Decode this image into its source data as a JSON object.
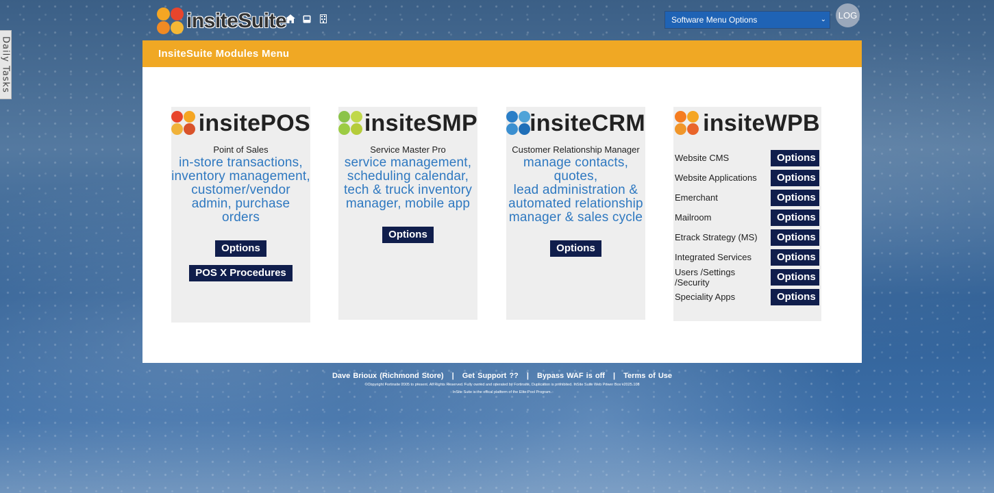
{
  "side_tab": {
    "label": "Daily Tasks"
  },
  "header": {
    "logo_text": "insiteSuite",
    "icons": [
      "home-icon",
      "inbox-icon",
      "building-icon"
    ],
    "menu_select": {
      "value": "Software Menu Options"
    },
    "log_button": "LOG"
  },
  "panel": {
    "title": "InsiteSuite Modules Menu",
    "modules": [
      {
        "name": "insitePOS",
        "subtitle": "Point of Sales",
        "desc_lines": [
          "in-store transactions,",
          "inventory management,",
          "customer/vendor",
          "admin, purchase orders"
        ],
        "buttons": [
          "Options",
          "POS X Procedures"
        ],
        "ball_colors": [
          "#e8452c",
          "#f5a623",
          "#f0b23a",
          "#d9532b"
        ]
      },
      {
        "name": "insiteSMP",
        "subtitle": "Service Master Pro",
        "desc_lines": [
          "service management,",
          "scheduling calendar,",
          "tech & truck inventory",
          "manager, mobile app"
        ],
        "buttons": [
          "Options"
        ],
        "ball_colors": [
          "#8bc34a",
          "#c0d84a",
          "#9ccc44",
          "#b5cc3a"
        ]
      },
      {
        "name": "insiteCRM",
        "subtitle": "Customer Relationship Manager",
        "desc_lines": [
          "manage contacts, quotes,",
          "lead administration &",
          "automated relationship",
          "manager & sales cycle"
        ],
        "buttons": [
          "Options"
        ],
        "ball_colors": [
          "#2a7ec7",
          "#4fa3d8",
          "#3b8fd0",
          "#1f6fb8"
        ]
      },
      {
        "name": "insiteWPB",
        "ball_colors": [
          "#f57c20",
          "#f5a623",
          "#f0962a",
          "#e9652a"
        ],
        "rows": [
          {
            "label": "Website CMS",
            "button": "Options"
          },
          {
            "label": "Website Applications",
            "button": "Options"
          },
          {
            "label": "Emerchant",
            "button": "Options"
          },
          {
            "label": "Mailroom",
            "button": "Options"
          },
          {
            "label": "Etrack Strategy (MS)",
            "button": "Options"
          },
          {
            "label": "Integrated Services",
            "button": "Options"
          },
          {
            "label": "Users /Settings /Security",
            "button": "Options"
          },
          {
            "label": "Speciality Apps",
            "button": "Options"
          }
        ]
      }
    ]
  },
  "footer": {
    "links": [
      "Dave Brioux (Richmond Store)",
      "Get Support ??",
      "Bypass WAF is off",
      "Terms of Use"
    ],
    "separator": "|",
    "copyright_line1": "©Copyright Fortinsite 2005 to present. All Rights Reserved. Fully owned and operated by Fortinsite, Duplication is prohibited. InSite Suite Web Power Box v2025.108",
    "copyright_line2": "InSite Suite is the offical platform of the Elite Pool Program."
  },
  "colors": {
    "header_bar": "#f0a824",
    "button_bg": "#101e4c",
    "desc_text": "#2e78c0",
    "select_bg": "#1f63b5"
  }
}
